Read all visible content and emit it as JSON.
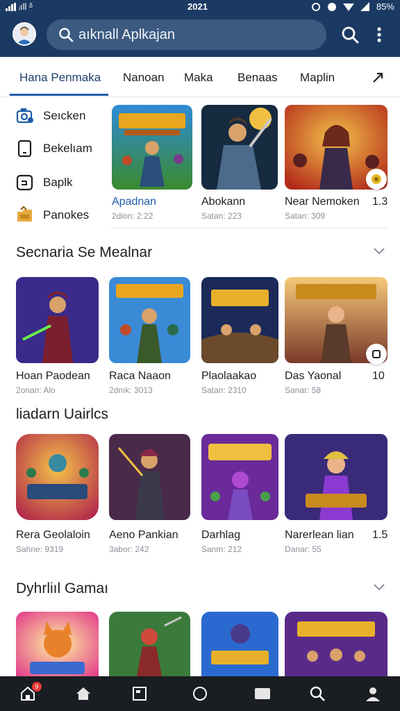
{
  "status_bar": {
    "carrier": "ᵢıll ᵟ",
    "time": "2021",
    "battery": "85%"
  },
  "header": {
    "search_text": "aıknall Aplkajan",
    "icons": [
      "avatar",
      "search-icon",
      "more-vert-icon"
    ]
  },
  "tabs": [
    {
      "label": "Hana Penmaka",
      "active": true
    },
    {
      "label": "Nanoan"
    },
    {
      "label": "Maka"
    },
    {
      "label": "Benaas"
    },
    {
      "label": "Maplin"
    }
  ],
  "sidebar": {
    "items": [
      {
        "label": "Seıcken",
        "icon": "camera-settings-icon"
      },
      {
        "label": "Bekelıam",
        "icon": "phone-icon"
      },
      {
        "label": "Baplk",
        "icon": "tablet-icon"
      },
      {
        "label": "Panokes",
        "icon": "folder-icon"
      }
    ]
  },
  "featured": [
    {
      "title": "Apadnan",
      "sub": "2dion: 2:22",
      "highlight": true
    },
    {
      "title": "Abokann",
      "sub": "Satan: 223"
    },
    {
      "title": "Near Nemoken",
      "sub": "Satan: 309"
    }
  ],
  "featured_extra": "1.3",
  "sections": [
    {
      "title": "Secnaria Se Mealnar",
      "items": [
        {
          "title": "Hoan Paodean",
          "sub": "2onan: Alo"
        },
        {
          "title": "Raca Naaon",
          "sub": "2dnık: 3013"
        },
        {
          "title": "Plaolaakao",
          "sub": "Satan: 2310"
        },
        {
          "title": "Das Yaonal",
          "sub": "Sanar: 58"
        }
      ],
      "extra": "10"
    },
    {
      "title": "liadarn Uairlcs",
      "items": [
        {
          "title": "Rera Geolaloin",
          "sub": "Sahne: 9319"
        },
        {
          "title": "Aeno Pankian",
          "sub": "3abor: 242"
        },
        {
          "title": "Darhlag",
          "sub": "Sanm: 212"
        },
        {
          "title": "Narerlean lian",
          "sub": "Danar: 55"
        }
      ],
      "extra": "1.5"
    },
    {
      "title": "Dyhrliıl Gamaı",
      "items": [
        {
          "title": "",
          "sub": ""
        },
        {
          "title": "",
          "sub": ""
        },
        {
          "title": "",
          "sub": ""
        },
        {
          "title": "",
          "sub": ""
        }
      ]
    }
  ],
  "bottom_nav": {
    "items": [
      "home-outline-icon",
      "home-icon",
      "square-icon",
      "circle-icon",
      "folder-icon",
      "search-icon",
      "person-icon"
    ],
    "badge": "9"
  },
  "colors": {
    "header": "#1b3a63",
    "accent": "#1f5ba8",
    "bottom_nav": "#1a1d22"
  }
}
